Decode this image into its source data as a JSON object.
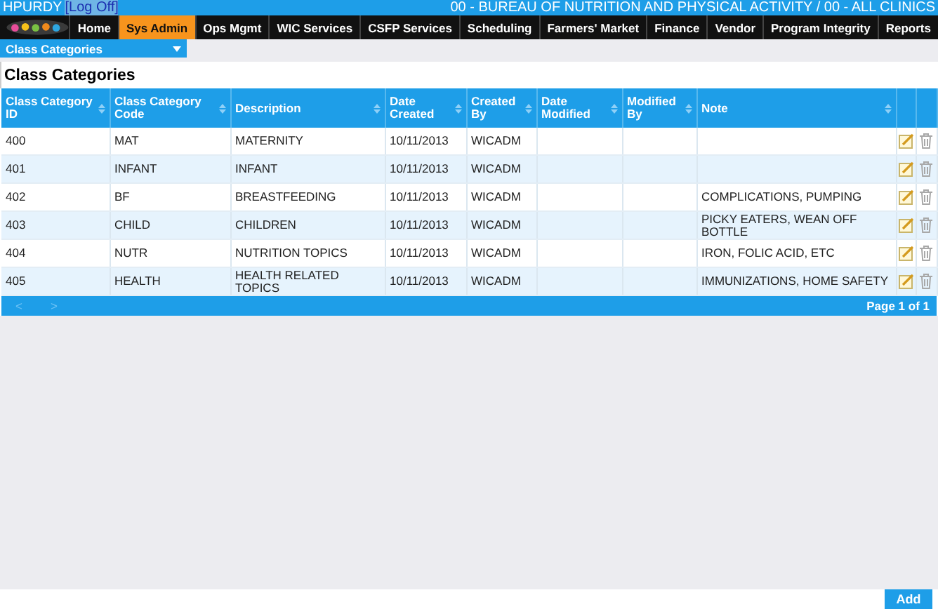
{
  "user_bar": {
    "user": "HPURDY",
    "logoff": "[Log Off]",
    "agency": "00 - BUREAU OF NUTRITION AND PHYSICAL ACTIVITY / 00 - ALL CLINICS"
  },
  "nav": [
    {
      "label": "Home",
      "selected": false
    },
    {
      "label": "Sys Admin",
      "selected": true
    },
    {
      "label": "Ops Mgmt",
      "selected": false
    },
    {
      "label": "WIC Services",
      "selected": false
    },
    {
      "label": "CSFP Services",
      "selected": false
    },
    {
      "label": "Scheduling",
      "selected": false
    },
    {
      "label": "Farmers' Market",
      "selected": false
    },
    {
      "label": "Finance",
      "selected": false
    },
    {
      "label": "Vendor",
      "selected": false
    },
    {
      "label": "Program Integrity",
      "selected": false
    },
    {
      "label": "Reports",
      "selected": false
    }
  ],
  "page_select": {
    "value": "Class Categories"
  },
  "page_title": "Class Categories",
  "table": {
    "columns": [
      "Class Category ID",
      "Class Category Code",
      "Description",
      "Date Created",
      "Created By",
      "Date Modified",
      "Modified By",
      "Note"
    ],
    "rows": [
      [
        "400",
        "MAT",
        "MATERNITY",
        "10/11/2013",
        "WICADM",
        "",
        "",
        ""
      ],
      [
        "401",
        "INFANT",
        "INFANT",
        "10/11/2013",
        "WICADM",
        "",
        "",
        ""
      ],
      [
        "402",
        "BF",
        "BREASTFEEDING",
        "10/11/2013",
        "WICADM",
        "",
        "",
        "COMPLICATIONS, PUMPING"
      ],
      [
        "403",
        "CHILD",
        "CHILDREN",
        "10/11/2013",
        "WICADM",
        "",
        "",
        "PICKY EATERS, WEAN OFF BOTTLE"
      ],
      [
        "404",
        "NUTR",
        "NUTRITION TOPICS",
        "10/11/2013",
        "WICADM",
        "",
        "",
        "IRON, FOLIC ACID, ETC"
      ],
      [
        "405",
        "HEALTH",
        "HEALTH RELATED TOPICS",
        "10/11/2013",
        "WICADM",
        "",
        "",
        "IMMUNIZATIONS, HOME SAFETY"
      ]
    ]
  },
  "pager": {
    "prev": "<",
    "next": ">",
    "page": "Page 1 of 1"
  },
  "add_button": "Add"
}
